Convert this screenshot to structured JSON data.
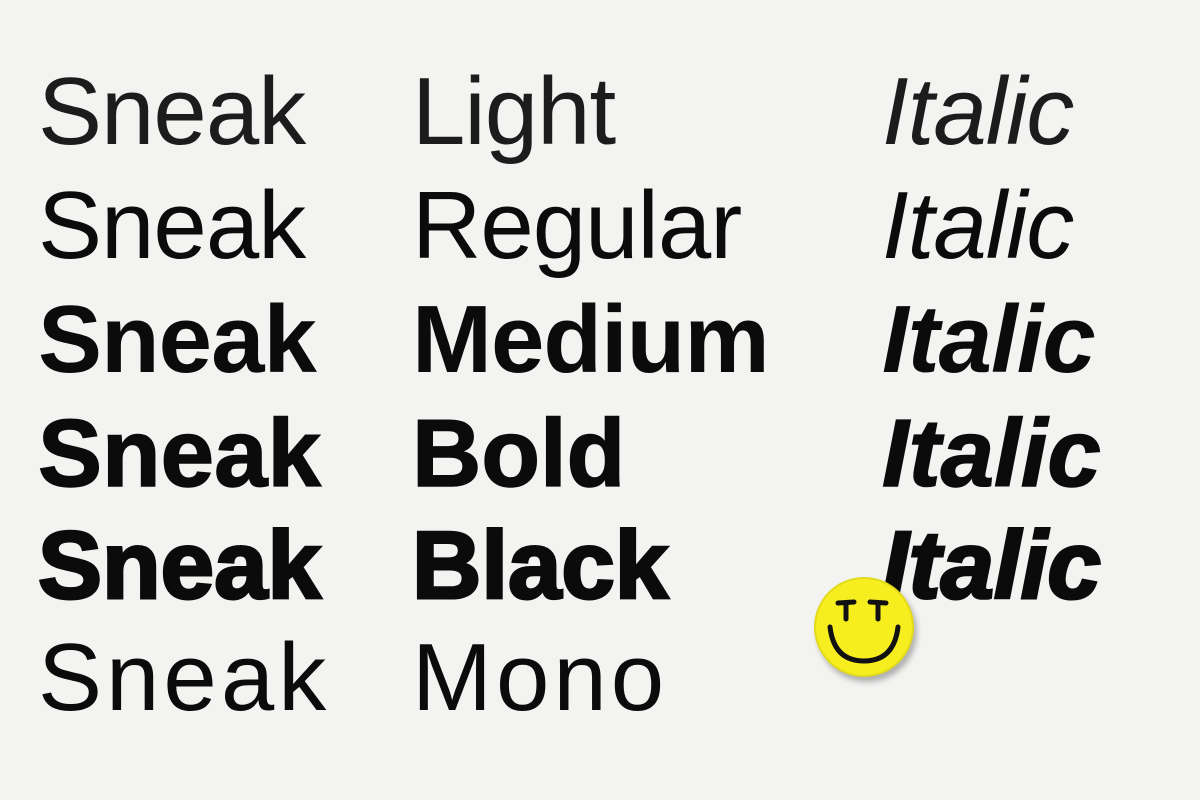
{
  "specimen": {
    "rows": [
      {
        "family": "Sneak",
        "weight": "Light",
        "italic": "Italic"
      },
      {
        "family": "Sneak",
        "weight": "Regular",
        "italic": "Italic"
      },
      {
        "family": "Sneak",
        "weight": "Medium",
        "italic": "Italic"
      },
      {
        "family": "Sneak",
        "weight": "Bold",
        "italic": "Italic"
      },
      {
        "family": "Sneak",
        "weight": "Black",
        "italic": "Italic"
      },
      {
        "family": "Sneak",
        "weight": "Mono"
      }
    ]
  },
  "sticker": {
    "icon": "smiley-face-icon",
    "color": "#f6ee1f"
  },
  "colors": {
    "background": "#f3f3f2",
    "text": "#0b0b0b"
  }
}
